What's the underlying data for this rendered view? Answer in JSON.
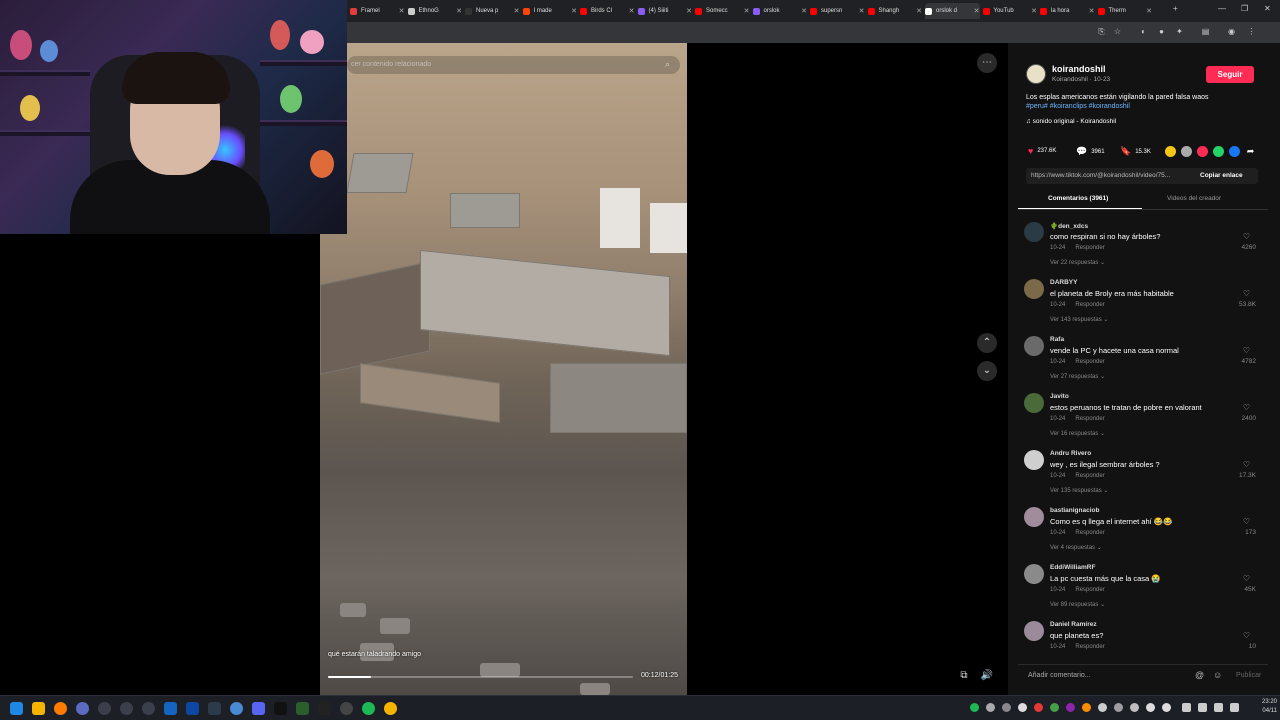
{
  "browser": {
    "tabs": [
      {
        "label": "Framel",
        "color": "#e63b3b"
      },
      {
        "label": "EthnoG",
        "color": "#cccccc"
      },
      {
        "label": "Nueva p",
        "color": "#333333"
      },
      {
        "label": "I made",
        "color": "#ff4500"
      },
      {
        "label": "Birds Cl",
        "color": "#ff0000"
      },
      {
        "label": "(4) Siiiti",
        "color": "#8a5cf6"
      },
      {
        "label": "Somecc",
        "color": "#ff0000"
      },
      {
        "label": "orslok",
        "color": "#8a5cf6"
      },
      {
        "label": "supersn",
        "color": "#ff0000"
      },
      {
        "label": "Shangh",
        "color": "#ff0000"
      },
      {
        "label": "orslok d",
        "color": "#ffffff"
      },
      {
        "label": "YouTub",
        "color": "#ff0000"
      },
      {
        "label": "la hora",
        "color": "#ff0000"
      },
      {
        "label": "Therm",
        "color": "#ff0000"
      }
    ]
  },
  "video": {
    "search_placeholder": "cer contenido relacionado",
    "caption": "qué estarán taladrando amigo",
    "time": "00:12/01:25",
    "progress": 0.14
  },
  "post": {
    "username": "koirandoshil",
    "subline": "Koirandoshil · 10-23",
    "follow_label": "Seguir",
    "description": "Los esplas americanos están vigilando la pared falsa waos",
    "hashtags": "#peru# #koiranclips #koirandoshil",
    "sound": "♫  sonido original - Koirandoshil",
    "likes": "237.6K",
    "comments": "3961",
    "saves": "15.3K",
    "url": "https://www.tiktok.com/@koirandoshil/video/75...",
    "copy_label": "Copiar enlace",
    "tab_comments": "Comentarios (3961)",
    "tab_creator": "Videos del creador",
    "comment_placeholder": "Añadir comentario...",
    "post_label": "Publicar"
  },
  "comments": [
    {
      "user": "🌵den_xdcs",
      "text": "como respiran si no hay árboles?",
      "date": "10-24",
      "reply": "Responder",
      "more": "Ver 22 respuestas ⌄",
      "likes": "4260",
      "color": "#2a3b45"
    },
    {
      "user": "DARBYY",
      "text": "el planeta de Broly era más habitable",
      "date": "10-24",
      "reply": "Responder",
      "more": "Ver 143 respuestas ⌄",
      "likes": "53.8K",
      "color": "#7a6a4a"
    },
    {
      "user": "Rafa",
      "text": "vende la PC y hacete una casa normal",
      "date": "10-24",
      "reply": "Responder",
      "more": "Ver 27 respuestas ⌄",
      "likes": "4782",
      "color": "#6a6a6a"
    },
    {
      "user": "Javito",
      "text": "estos peruanos te tratan de pobre en valorant",
      "date": "10-24",
      "reply": "Responder",
      "more": "Ver 16 respuestas ⌄",
      "likes": "2400",
      "color": "#4a6a3a"
    },
    {
      "user": "Andru Rivero",
      "text": "wey , es ilegal sembrar árboles ?",
      "date": "10-24",
      "reply": "Responder",
      "more": "Ver 135 respuestas ⌄",
      "likes": "17.3K",
      "color": "#cfcfcf"
    },
    {
      "user": "bastianignaciob",
      "text": "Como es q llega el internet ahí 😂😂",
      "date": "10-24",
      "reply": "Responder",
      "more": "Ver 4 respuestas ⌄",
      "likes": "173",
      "color": "#a08c9a"
    },
    {
      "user": "EddiWilliamRF",
      "text": "La pc cuesta más que la casa 😭",
      "date": "10-24",
      "reply": "Responder",
      "more": "Ver 89 respuestas ⌄",
      "likes": "45K",
      "color": "#8a8a8a"
    },
    {
      "user": "Daniel Ramírez",
      "text": "que planeta es?",
      "date": "10-24",
      "reply": "Responder",
      "more": "",
      "likes": "10",
      "color": "#9a8a9a"
    }
  ],
  "taskbar": {
    "time": "23:20",
    "date": "04/11"
  },
  "colors": {
    "accent": "#fe2c55",
    "hashtag": "#6fb7ff",
    "panel_bg": "#121212"
  }
}
